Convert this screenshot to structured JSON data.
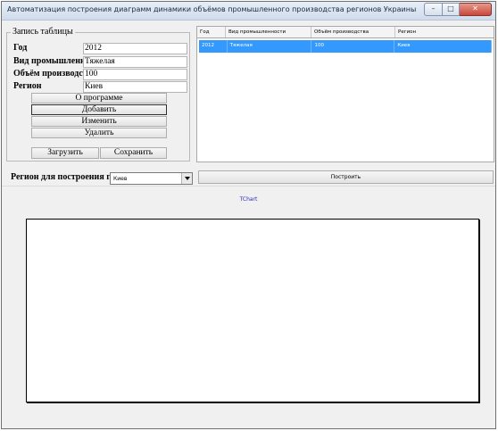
{
  "window": {
    "title": "Автоматизация построения диаграмм динамики объёмов промышленного производства регионов Украины",
    "buttons": {
      "minimize": "–",
      "maximize": "□",
      "close": "✕"
    }
  },
  "form": {
    "legend": "Запись таблицы",
    "fields": [
      {
        "label": "Год",
        "value": "2012"
      },
      {
        "label": "Вид промышленности",
        "value": "Тяжелая"
      },
      {
        "label": "Объём производства",
        "value": "100"
      },
      {
        "label": "Регион",
        "value": "Киев"
      }
    ],
    "buttons": {
      "about": "О программе",
      "add": "Добавить",
      "edit": "Изменить",
      "delete": "Удалить",
      "load": "Загрузить",
      "save": "Сохранить"
    }
  },
  "table": {
    "columns": [
      "Год",
      "Вид промышленности",
      "Объём производства",
      "Регион"
    ],
    "rows": [
      [
        "2012",
        "Тяжелая",
        "100",
        "Киев"
      ]
    ]
  },
  "chart_controls": {
    "region_label": "Регион для построения графика",
    "region_value": "Киев",
    "build_button": "Построить"
  },
  "chart": {
    "title": "TChart"
  }
}
